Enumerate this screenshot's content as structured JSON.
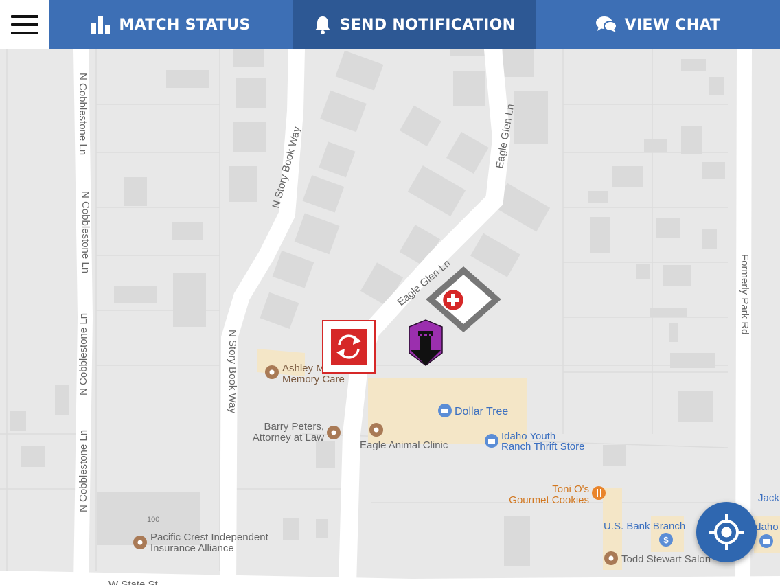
{
  "nav": {
    "menu_icon": "hamburger-menu-icon",
    "tabs": [
      {
        "label": "MATCH STATUS",
        "icon": "bar-chart-icon"
      },
      {
        "label": "SEND NOTIFICATION",
        "icon": "bell-icon"
      },
      {
        "label": "VIEW CHAT",
        "icon": "chat-bubbles-icon"
      }
    ]
  },
  "map": {
    "streets": {
      "cobblestone_1": "N Cobblestone Ln",
      "cobblestone_2": "N Cobblestone Ln",
      "cobblestone_3": "N Cobblestone Ln",
      "cobblestone_4": "N Cobblestone Ln",
      "storybook_1": "N Story Book Way",
      "storybook_2": "N Story Book Way",
      "eagleglen_1": "Eagle Glen Ln",
      "eagleglen_2": "Eagle Glen Ln",
      "formerly_park": "Formerly Park Rd",
      "w_state": "W State St"
    },
    "places": {
      "ashley_line1": "Ashley M",
      "ashley_line2": "Memory Care",
      "dollar_tree": "Dollar Tree",
      "barry_line1": "Barry Peters,",
      "barry_line2": "Attorney at Law",
      "eagle_animal": "Eagle Animal Clinic",
      "idaho_line1": "Idaho Youth",
      "idaho_line2": "Ranch Thrift Store",
      "toni_line1": "Toni O's",
      "toni_line2": "Gourmet Cookies",
      "us_bank": "U.S. Bank Branch",
      "todd": "Todd Stewart Salon",
      "jack": "Jack",
      "idaho_partial": "Idaho S",
      "pacific_line1": "Pacific Crest Independent",
      "pacific_line2": "Insurance Alliance",
      "address_100": "100"
    },
    "markers": {
      "respawn": "respawn-marker-icon",
      "medic": "medic-marker-icon",
      "tower": "tower-marker-icon"
    },
    "colors": {
      "map_bg": "#e8e8e8",
      "road": "#ffffff",
      "building": "#dadada",
      "commercial": "#f4e6c7",
      "poi_brown": "#a97a56",
      "poi_blue": "#5b8dd6",
      "poi_orange": "#e9852c",
      "marker_red": "#d62828",
      "tower_purple": "#9b2fae",
      "medic_gray": "#777777"
    }
  },
  "locate_button": {
    "icon": "crosshair-locate-icon"
  }
}
